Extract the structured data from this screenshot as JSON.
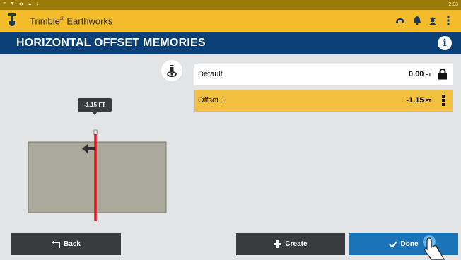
{
  "status_bar": {
    "time": "2:03",
    "icons": [
      "usb-icon",
      "location-icon",
      "settings-icon",
      "warning-icon",
      "download-icon"
    ]
  },
  "app_bar": {
    "app_name": "Trimble",
    "app_name_mark": "®",
    "app_name_suffix": " Earthworks",
    "icons": [
      "machine-icon",
      "bell-icon",
      "operator-icon",
      "overflow-menu-icon"
    ]
  },
  "header": {
    "title": "HORIZONTAL OFFSET MEMORIES",
    "info_glyph": "i"
  },
  "view": {
    "offset_label": "-1.15 FT",
    "offset_value_ft": -1.15
  },
  "offsets": [
    {
      "name": "Default",
      "value": "0.00",
      "unit": "FT",
      "locked": true
    },
    {
      "name": "Offset 1",
      "value": "-1.15",
      "unit": "FT",
      "selected": true
    }
  ],
  "buttons": {
    "back": "Back",
    "create": "Create",
    "done": "Done"
  },
  "colors": {
    "accent_yellow": "#f4bb2a",
    "header_blue": "#0a3f78",
    "selected_row": "#f2c03f",
    "done_blue": "#1a72b7",
    "offset_line_red": "#e01b1b"
  }
}
